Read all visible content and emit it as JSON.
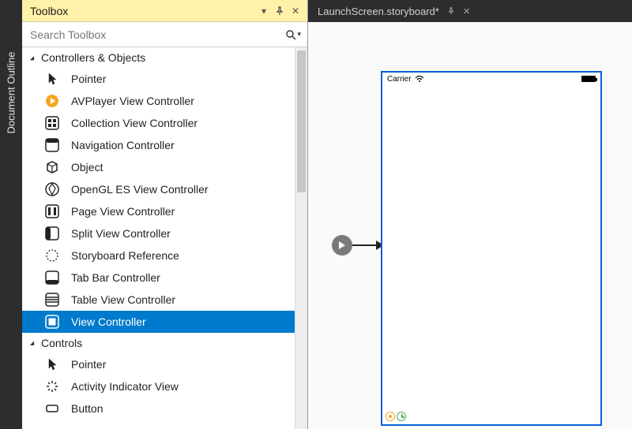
{
  "side_tab": {
    "label": "Document Outline"
  },
  "toolbox": {
    "title": "Toolbox",
    "search_placeholder": "Search Toolbox",
    "groups": [
      {
        "name": "Controllers & Objects",
        "items": [
          {
            "label": "Pointer",
            "icon": "pointer"
          },
          {
            "label": "AVPlayer View Controller",
            "icon": "avplayer"
          },
          {
            "label": "Collection View Controller",
            "icon": "collection"
          },
          {
            "label": "Navigation Controller",
            "icon": "navigation"
          },
          {
            "label": "Object",
            "icon": "object"
          },
          {
            "label": "OpenGL ES View Controller",
            "icon": "opengl"
          },
          {
            "label": "Page View Controller",
            "icon": "page"
          },
          {
            "label": "Split View Controller",
            "icon": "split"
          },
          {
            "label": "Storyboard Reference",
            "icon": "storyboardref"
          },
          {
            "label": "Tab Bar Controller",
            "icon": "tabbar"
          },
          {
            "label": "Table View Controller",
            "icon": "table"
          },
          {
            "label": "View Controller",
            "icon": "view",
            "selected": true
          }
        ]
      },
      {
        "name": "Controls",
        "items": [
          {
            "label": "Pointer",
            "icon": "pointer"
          },
          {
            "label": "Activity Indicator View",
            "icon": "activity"
          },
          {
            "label": "Button",
            "icon": "button"
          }
        ]
      }
    ]
  },
  "document": {
    "tab_label": "LaunchScreen.storyboard*",
    "statusbar_carrier": "Carrier"
  }
}
